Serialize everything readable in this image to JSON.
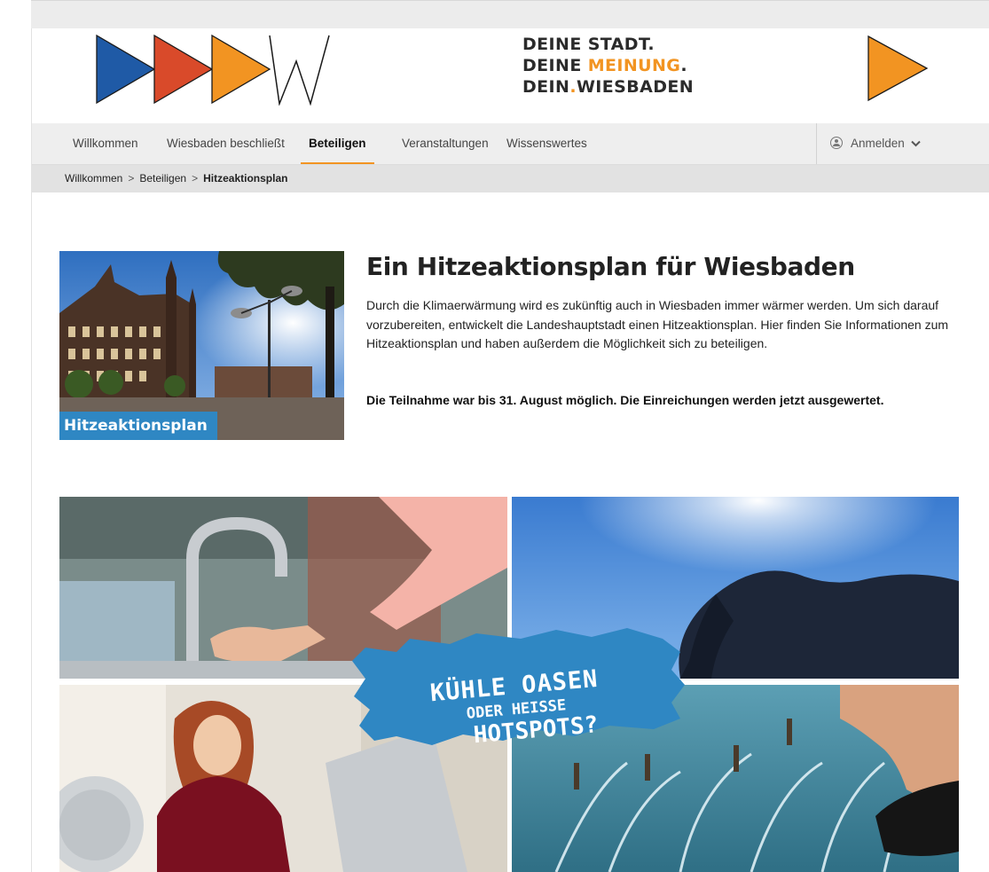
{
  "header": {
    "slogan": {
      "line1": "DEINE STADT.",
      "line2_prefix": "DEINE ",
      "line2_highlight": "MEINUNG",
      "line2_suffix": ".",
      "line3_prefix": "DEIN",
      "line3_dot": ".",
      "line3_suffix": "WIESBADEN"
    },
    "logo_name": "logo-triangles-w",
    "play_icon": "play-triangle-icon"
  },
  "colors": {
    "blue": "#1f5aa6",
    "red": "#d94a2a",
    "orange": "#f29422",
    "accent_blue": "#2f87c3"
  },
  "nav": {
    "items": [
      {
        "label": "Willkommen",
        "active": false
      },
      {
        "label": "Wiesbaden beschließt",
        "active": false
      },
      {
        "label": "Beteiligen",
        "active": true
      },
      {
        "label": "Veranstaltungen",
        "active": false
      },
      {
        "label": "Wissenswertes",
        "active": false
      }
    ],
    "login_label": "Anmelden",
    "login_icon": "user-circle-icon",
    "login_chevron": "chevron-down-icon"
  },
  "breadcrumb": {
    "items": [
      "Willkommen",
      "Beteiligen"
    ],
    "separator": ">",
    "current": "Hitzeaktionsplan"
  },
  "intro": {
    "image_label": "Hitzeaktionsplan",
    "title": "Ein Hitzeaktionsplan für Wiesbaden",
    "text": "Durch die Klimaerwärmung wird es zukünftig auch in Wiesbaden immer wärmer werden. Um sich darauf vorzubereiten, entwickelt die Landeshauptstadt einen Hitzeaktionsplan. Hier finden Sie Informationen zum Hitzeaktionsplan und haben außerdem die Möglichkeit sich zu beteiligen.",
    "note": "Die Teilnahme war bis 31. August möglich. Die Einreichungen werden jetzt ausgewertet."
  },
  "hero": {
    "line1": "KÜHLE OASEN",
    "line2": "ODER HEISSE",
    "line3": "HOTSPOTS?"
  }
}
